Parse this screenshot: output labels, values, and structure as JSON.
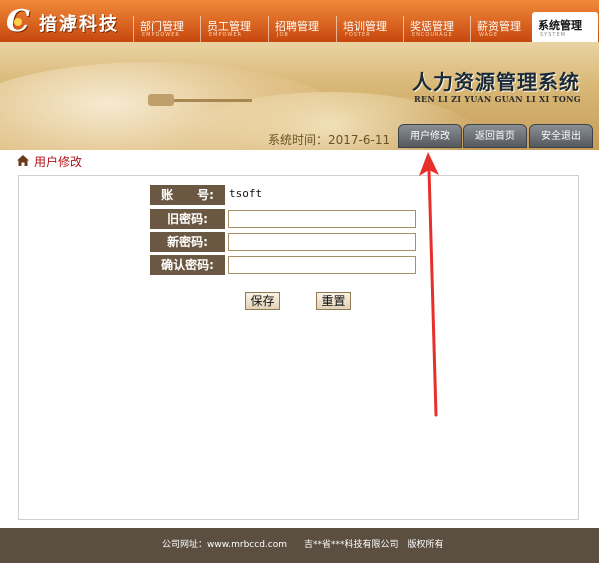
{
  "brand": {
    "name": "揞滹科技"
  },
  "nav": {
    "items": [
      {
        "label": "部门管理",
        "sub": "EMPDOWER"
      },
      {
        "label": "员工管理",
        "sub": "EMPOWER"
      },
      {
        "label": "招聘管理",
        "sub": "JOB"
      },
      {
        "label": "培训管理",
        "sub": "FOSTER"
      },
      {
        "label": "奖惩管理",
        "sub": "ENCOURAGE"
      },
      {
        "label": "薪资管理",
        "sub": "WAGE"
      },
      {
        "label": "系统管理",
        "sub": "SYSTEM",
        "active": true
      }
    ]
  },
  "banner": {
    "title": "人力资源管理系统",
    "subtitle": "REN LI ZI YUAN GUAN LI XI TONG",
    "time_label": "系统时间：2017-6-11",
    "buttons": {
      "user_edit": "用户修改",
      "back_home": "返回首页",
      "logout": "安全退出"
    }
  },
  "breadcrumb": {
    "label": "用户修改"
  },
  "form": {
    "account_label": "账　　号:",
    "account_value": "tsoft",
    "old_pwd_label": "旧密码:",
    "new_pwd_label": "新密码:",
    "confirm_pwd_label": "确认密码:",
    "old_pwd_value": "",
    "new_pwd_value": "",
    "confirm_pwd_value": "",
    "save_label": "保存",
    "reset_label": "重置"
  },
  "footer": {
    "url_text": "公司网址：www.mrbccd.com",
    "copyright_text": "吉**省***科技有限公司　版权所有"
  },
  "colors": {
    "nav_orange": "#d8601f",
    "label_brown": "#6b5842",
    "breadcrumb_red": "#b0151a",
    "footer_brown": "#5b4f41",
    "arrow_red": "#e8302a"
  }
}
